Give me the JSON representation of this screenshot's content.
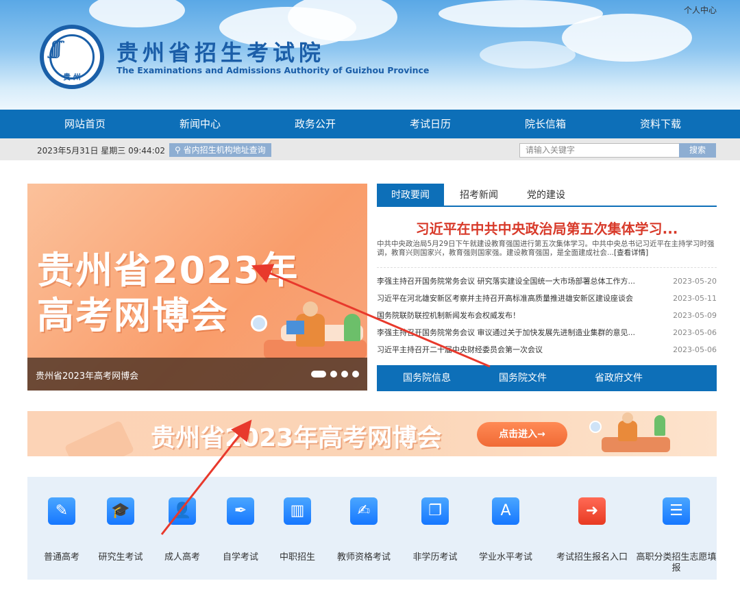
{
  "header": {
    "personal_center": "个人中心",
    "logo_label": "贵 州",
    "site_title": "贵州省招生考试院",
    "site_subtitle": "The Examinations and Admissions Authority of Guizhou Province"
  },
  "nav": {
    "items": [
      "网站首页",
      "新闻中心",
      "政务公开",
      "考试日历",
      "院长信箱",
      "资料下载"
    ]
  },
  "infobar": {
    "datetime": "2023年5月31日 星期三 09:44:02",
    "location_query": "省内招生机构地址查询",
    "search_placeholder": "请输入关键字",
    "search_button": "搜索"
  },
  "banner": {
    "line1": "贵州省2023年",
    "line2": "高考网博会",
    "caption": "贵州省2023年高考网博会"
  },
  "news": {
    "tabs": [
      "时政要闻",
      "招考新闻",
      "党的建设"
    ],
    "headline": "习近平在中共中央政治局第五次集体学习...",
    "summary": "中共中央政治局5月29日下午就建设教育强国进行第五次集体学习。中共中央总书记习近平在主持学习时强调，教育兴则国家兴，教育强则国家强。建设教育强国，是全面建成社会...",
    "summary_link": "[查看详情]",
    "items": [
      {
        "title": "李强主持召开国务院常务会议 研究落实建设全国统一大市场部署总体工作方...",
        "date": "2023-05-20"
      },
      {
        "title": "习近平在河北雄安新区考察并主持召开高标准高质量推进雄安新区建设座谈会",
        "date": "2023-05-11"
      },
      {
        "title": "国务院联防联控机制新闻发布会权威发布！",
        "date": "2023-05-09"
      },
      {
        "title": "李强主持召开国务院常务会议 审议通过关于加快发展先进制造业集群的意见...",
        "date": "2023-05-06"
      },
      {
        "title": "习近平主持召开二十届中央财经委员会第一次会议",
        "date": "2023-05-06"
      }
    ],
    "quick_links": [
      "国务院信息",
      "国务院文件",
      "省政府文件"
    ]
  },
  "wide_banner": {
    "title": "贵州省2023年高考网博会",
    "enter": "点击进入→"
  },
  "services": [
    {
      "label": "普通高考",
      "icon": "pen-icon"
    },
    {
      "label": "研究生考试",
      "icon": "graduation-cap-icon"
    },
    {
      "label": "成人高考",
      "icon": "adult-person-icon"
    },
    {
      "label": "自学考试",
      "icon": "pen-nib-icon"
    },
    {
      "label": "中职招生",
      "icon": "books-icon"
    },
    {
      "label": "教师资格考试",
      "icon": "teacher-icon"
    },
    {
      "label": "非学历考试",
      "icon": "bookmark-icon"
    },
    {
      "label": "学业水平考试",
      "icon": "grade-a-icon"
    },
    {
      "label": "考试招生报名入口",
      "icon": "entry-arrow-icon"
    },
    {
      "label": "高职分类招生志愿填报",
      "icon": "form-fill-icon"
    }
  ],
  "colors": {
    "primary_blue": "#0d6fb8",
    "headline_red": "#d83a2a",
    "annotation_red": "#e8392c"
  }
}
